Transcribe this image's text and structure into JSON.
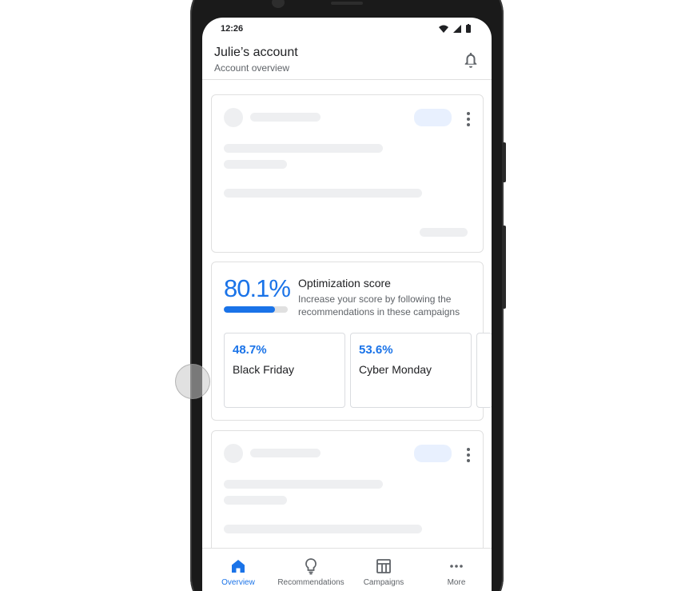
{
  "status_bar": {
    "time": "12:26"
  },
  "header": {
    "title": "Julie’s account",
    "subtitle": "Account overview",
    "icons": {
      "notifications": "bell-icon"
    }
  },
  "optimization": {
    "score_text": "80.1%",
    "score_fraction": 0.801,
    "title": "Optimization score",
    "description": "Increase your score by following the recommendations in these campaigns",
    "campaigns": [
      {
        "score": "48.7%",
        "name": "Black Friday"
      },
      {
        "score": "53.6%",
        "name": "Cyber Monday"
      }
    ]
  },
  "bottom_nav": {
    "items": [
      {
        "label": "Overview",
        "icon": "home-icon",
        "active": true
      },
      {
        "label": "Recommendations",
        "icon": "lightbulb-icon",
        "active": false
      },
      {
        "label": "Campaigns",
        "icon": "campaigns-table-icon",
        "active": false
      },
      {
        "label": "More",
        "icon": "more-horizontal-icon",
        "active": false
      }
    ]
  },
  "colors": {
    "accent": "#1a73e8",
    "text_primary": "#202124",
    "text_secondary": "#5f6368",
    "skeleton": "#eeeff1",
    "skeleton_pill": "#e8f0fe"
  }
}
